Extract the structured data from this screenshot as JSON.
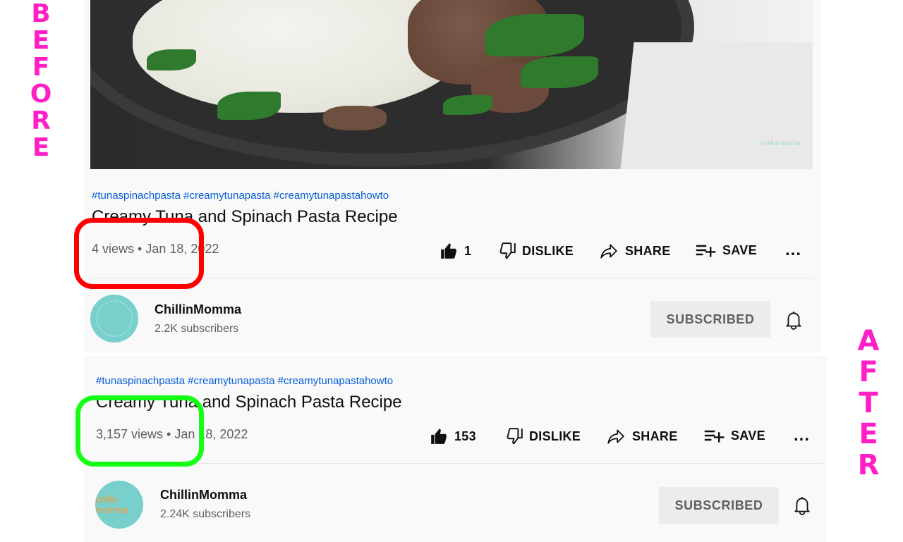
{
  "labels": {
    "before_letters": [
      "B",
      "E",
      "F",
      "O",
      "R",
      "E"
    ],
    "after_letters": [
      "A",
      "F",
      "T",
      "E",
      "R"
    ]
  },
  "before": {
    "thumbnail_watermark": "chillinmomma",
    "hashtags": "#tunaspinachpasta #creamytunapasta #creamytunapastahowto",
    "title": "Creamy Tuna and Spinach Pasta Recipe",
    "views_date": "4 views • Jan 18, 2022",
    "like_count": "1",
    "dislike_label": "DISLIKE",
    "share_label": "SHARE",
    "save_label": "SAVE",
    "more_label": "...",
    "channel_name": "ChillinMomma",
    "subscribers": "2.2K subscribers",
    "subscribe_label": "SUBSCRIBED"
  },
  "after": {
    "hashtags": "#tunaspinachpasta #creamytunapasta #creamytunapastahowto",
    "title": "Creamy Tuna and Spinach Pasta Recipe",
    "views_date": "3,157 views • Jan 18, 2022",
    "like_count": "153",
    "dislike_label": "DISLIKE",
    "share_label": "SHARE",
    "save_label": "SAVE",
    "more_label": "...",
    "channel_name": "ChillinMomma",
    "avatar_text": "chillin momma",
    "subscribers": "2.24K subscribers",
    "subscribe_label": "SUBSCRIBED"
  },
  "colors": {
    "label_pink": "#ff1fc7",
    "highlight_red": "#ff0000",
    "highlight_green": "#15ff15",
    "hashtag_blue": "#065fd4"
  },
  "icons": {
    "like": "thumbs-up-icon",
    "dislike": "thumbs-down-icon",
    "share": "share-arrow-icon",
    "save": "playlist-add-icon",
    "bell": "bell-icon"
  }
}
